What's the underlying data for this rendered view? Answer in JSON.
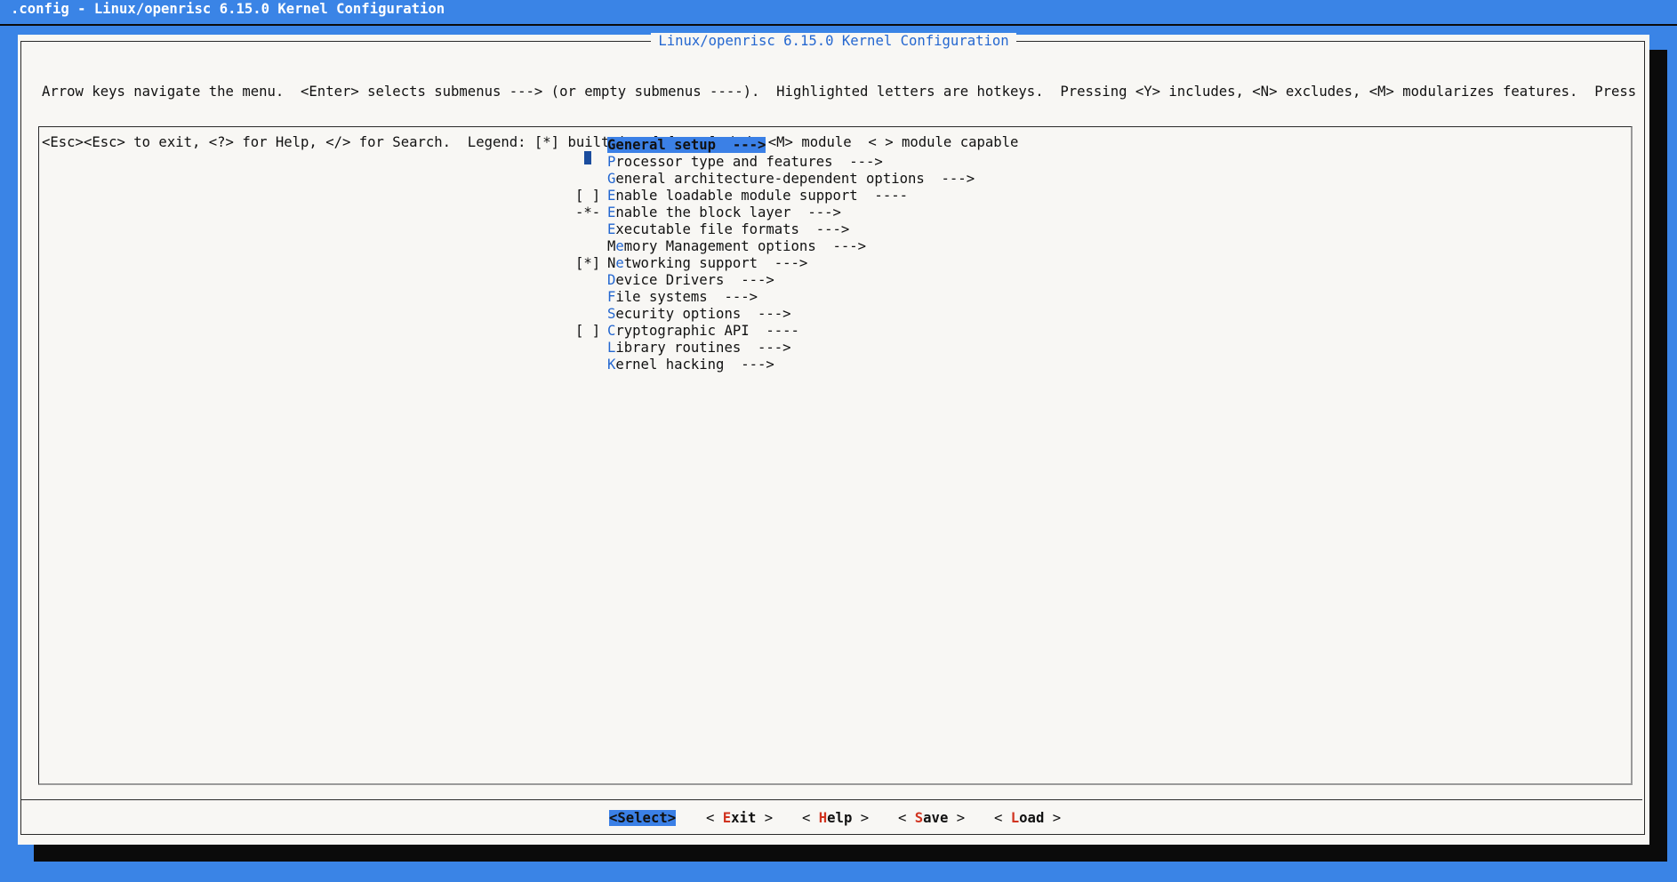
{
  "window": {
    "title": ".config - Linux/openrisc 6.15.0 Kernel Configuration"
  },
  "dialog": {
    "title": "Linux/openrisc 6.15.0 Kernel Configuration",
    "help_line1": "Arrow keys navigate the menu.  <Enter> selects submenus ---> (or empty submenus ----).  Highlighted letters are hotkeys.  Pressing <Y> includes, <N> excludes, <M> modularizes features.  Press",
    "help_line2": "<Esc><Esc> to exit, <?> for Help, </> for Search.  Legend: [*] built-in  [ ] excluded  <M> module  < > module capable"
  },
  "menu": {
    "items": [
      {
        "prefix": "",
        "hotkey": "G",
        "rest": "eneral setup  --->",
        "selected": true
      },
      {
        "prefix": "",
        "hotkey": "P",
        "rest": "rocessor type and features  --->"
      },
      {
        "prefix": "",
        "hotkey": "G",
        "rest": "eneral architecture-dependent options  --->"
      },
      {
        "prefix": "[ ]",
        "hotkey": "E",
        "rest": "nable loadable module support  ----"
      },
      {
        "prefix": "-*-",
        "hotkey": "E",
        "rest": "nable the block layer  --->"
      },
      {
        "prefix": "",
        "hotkey": "E",
        "rest": "xecutable file formats  --->"
      },
      {
        "prefix": "",
        "hotkey": "M",
        "pre": "",
        "rest": "emory Management options  --->",
        "hk_pos": 1
      },
      {
        "prefix": "[*]",
        "hotkey": "N",
        "rest": "etworking support  --->",
        "hk_pos": 1
      },
      {
        "prefix": "",
        "hotkey": "D",
        "rest": "evice Drivers  --->"
      },
      {
        "prefix": "",
        "hotkey": "F",
        "rest": "ile systems  --->"
      },
      {
        "prefix": "",
        "hotkey": "S",
        "rest": "ecurity options  --->"
      },
      {
        "prefix": "[ ]",
        "hotkey": "C",
        "rest": "ryptographic API  ----"
      },
      {
        "prefix": "",
        "hotkey": "L",
        "rest": "ibrary routines  --->"
      },
      {
        "prefix": "",
        "hotkey": "K",
        "rest": "ernel hacking  --->"
      }
    ]
  },
  "buttons": [
    {
      "label": "<Select>",
      "selected": true
    },
    {
      "open": "< ",
      "hotkey": "E",
      "rest": "xit",
      "close": " >"
    },
    {
      "open": "< ",
      "hotkey": "H",
      "rest": "elp",
      "close": " >"
    },
    {
      "open": "< ",
      "hotkey": "S",
      "rest": "ave",
      "close": " >"
    },
    {
      "open": "< ",
      "hotkey": "L",
      "rest": "oad",
      "close": " >"
    }
  ],
  "colors": {
    "background": "#3a84e6",
    "highlight": "#3b80e6",
    "hotkey": "#2467d0",
    "button_hotkey": "#d0331f"
  }
}
